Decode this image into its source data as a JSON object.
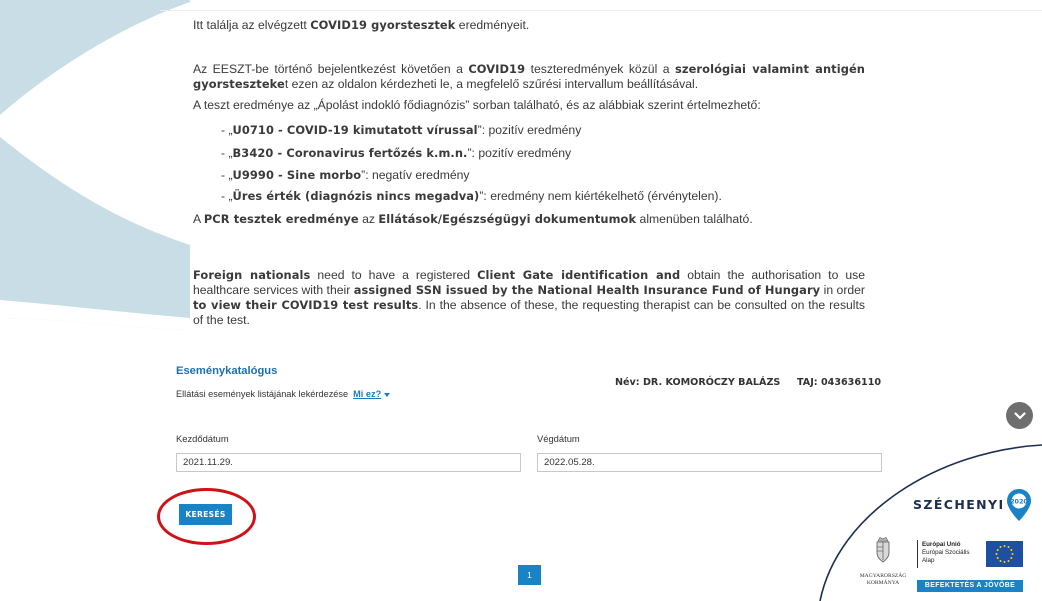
{
  "intro": {
    "line1": [
      "Itt találja az elvégzett ",
      "COVID19 gyorstesztek",
      " eredményeit."
    ],
    "para2": [
      "Az EESZT-be történő bejelentkezést követően a ",
      "COVID19",
      " teszteredmények közül a ",
      "szerológiai valamint antigén gyorsteszteke",
      "t ezen az oldalon kérdezheti le, a megfelelő szűrési intervallum beállításával."
    ],
    "line3": "A teszt eredménye az „Ápolást indokló fődiagnózis” sorban található, és az alábbiak szerint értelmezhető:",
    "items": [
      {
        "prefix": "- „",
        "code": "U0710 - COVID-19 kimutatott vírussal",
        "suffix": "”: pozitív eredmény"
      },
      {
        "prefix": "- „",
        "code": "B3420 - Coronavirus fertőzés k.m.n.",
        "suffix": "”: pozitív eredmény"
      },
      {
        "prefix": "- „",
        "code": "U9990 - Sine morbo",
        "suffix": "”: negatív eredmény"
      },
      {
        "prefix": "- „",
        "code": "Üres érték (diagnózis nincs megadva)",
        "suffix": "”: eredmény nem kiértékelhető (érvénytelen)."
      }
    ],
    "pcr": [
      "A ",
      "PCR tesztek eredménye",
      " az ",
      "Ellátások/Egészségügyi dokumentumok",
      " almenüben található."
    ]
  },
  "foreign": [
    "Foreign nationals",
    " need to have a registered ",
    "Client Gate identification and",
    " obtain the authorisation to use healthcare services with their ",
    "assigned SSN issued by the National Health Insurance Fund of Hungary",
    " in order ",
    "to view their COVID19 test results",
    ". In the absence of these, the requesting therapist can be consulted on the results of the test."
  ],
  "catalog": {
    "title": "Eseménykatalógus",
    "subtitle": "Ellátási események listájának lekérdezése",
    "help_link": "Mi ez?",
    "patient_name": "Név: DR. KOMORÓCZY BALÁZS",
    "taj": "TAJ: 043636110"
  },
  "form": {
    "start_label": "Kezdődátum",
    "start_value": "2021.11.29.",
    "end_label": "Végdátum",
    "end_value": "2022.05.28.",
    "search_button": "KERESÉS"
  },
  "pagination": {
    "current_page": "1"
  },
  "badge": {
    "szechenyi": "SZÉCHENYI",
    "year": "2020",
    "eu_line1": "Európai Unió",
    "eu_line2": "Európai Szociális",
    "eu_line3": "Alap",
    "gov_line1": "MAGYARORSZÁG",
    "gov_line2": "KORMÁNYA",
    "slogan": "BEFEKTETÉS A JÖVŐBE"
  },
  "colors": {
    "accent": "#1a83c6",
    "highlight_ring": "#d01217",
    "deco": "#c9dde6",
    "badge_navy": "#1c2f50"
  },
  "icons": [
    "chevron-down-icon",
    "szechenyi-pin-icon",
    "hungarian-coat-of-arms-icon",
    "eu-flag-icon"
  ]
}
